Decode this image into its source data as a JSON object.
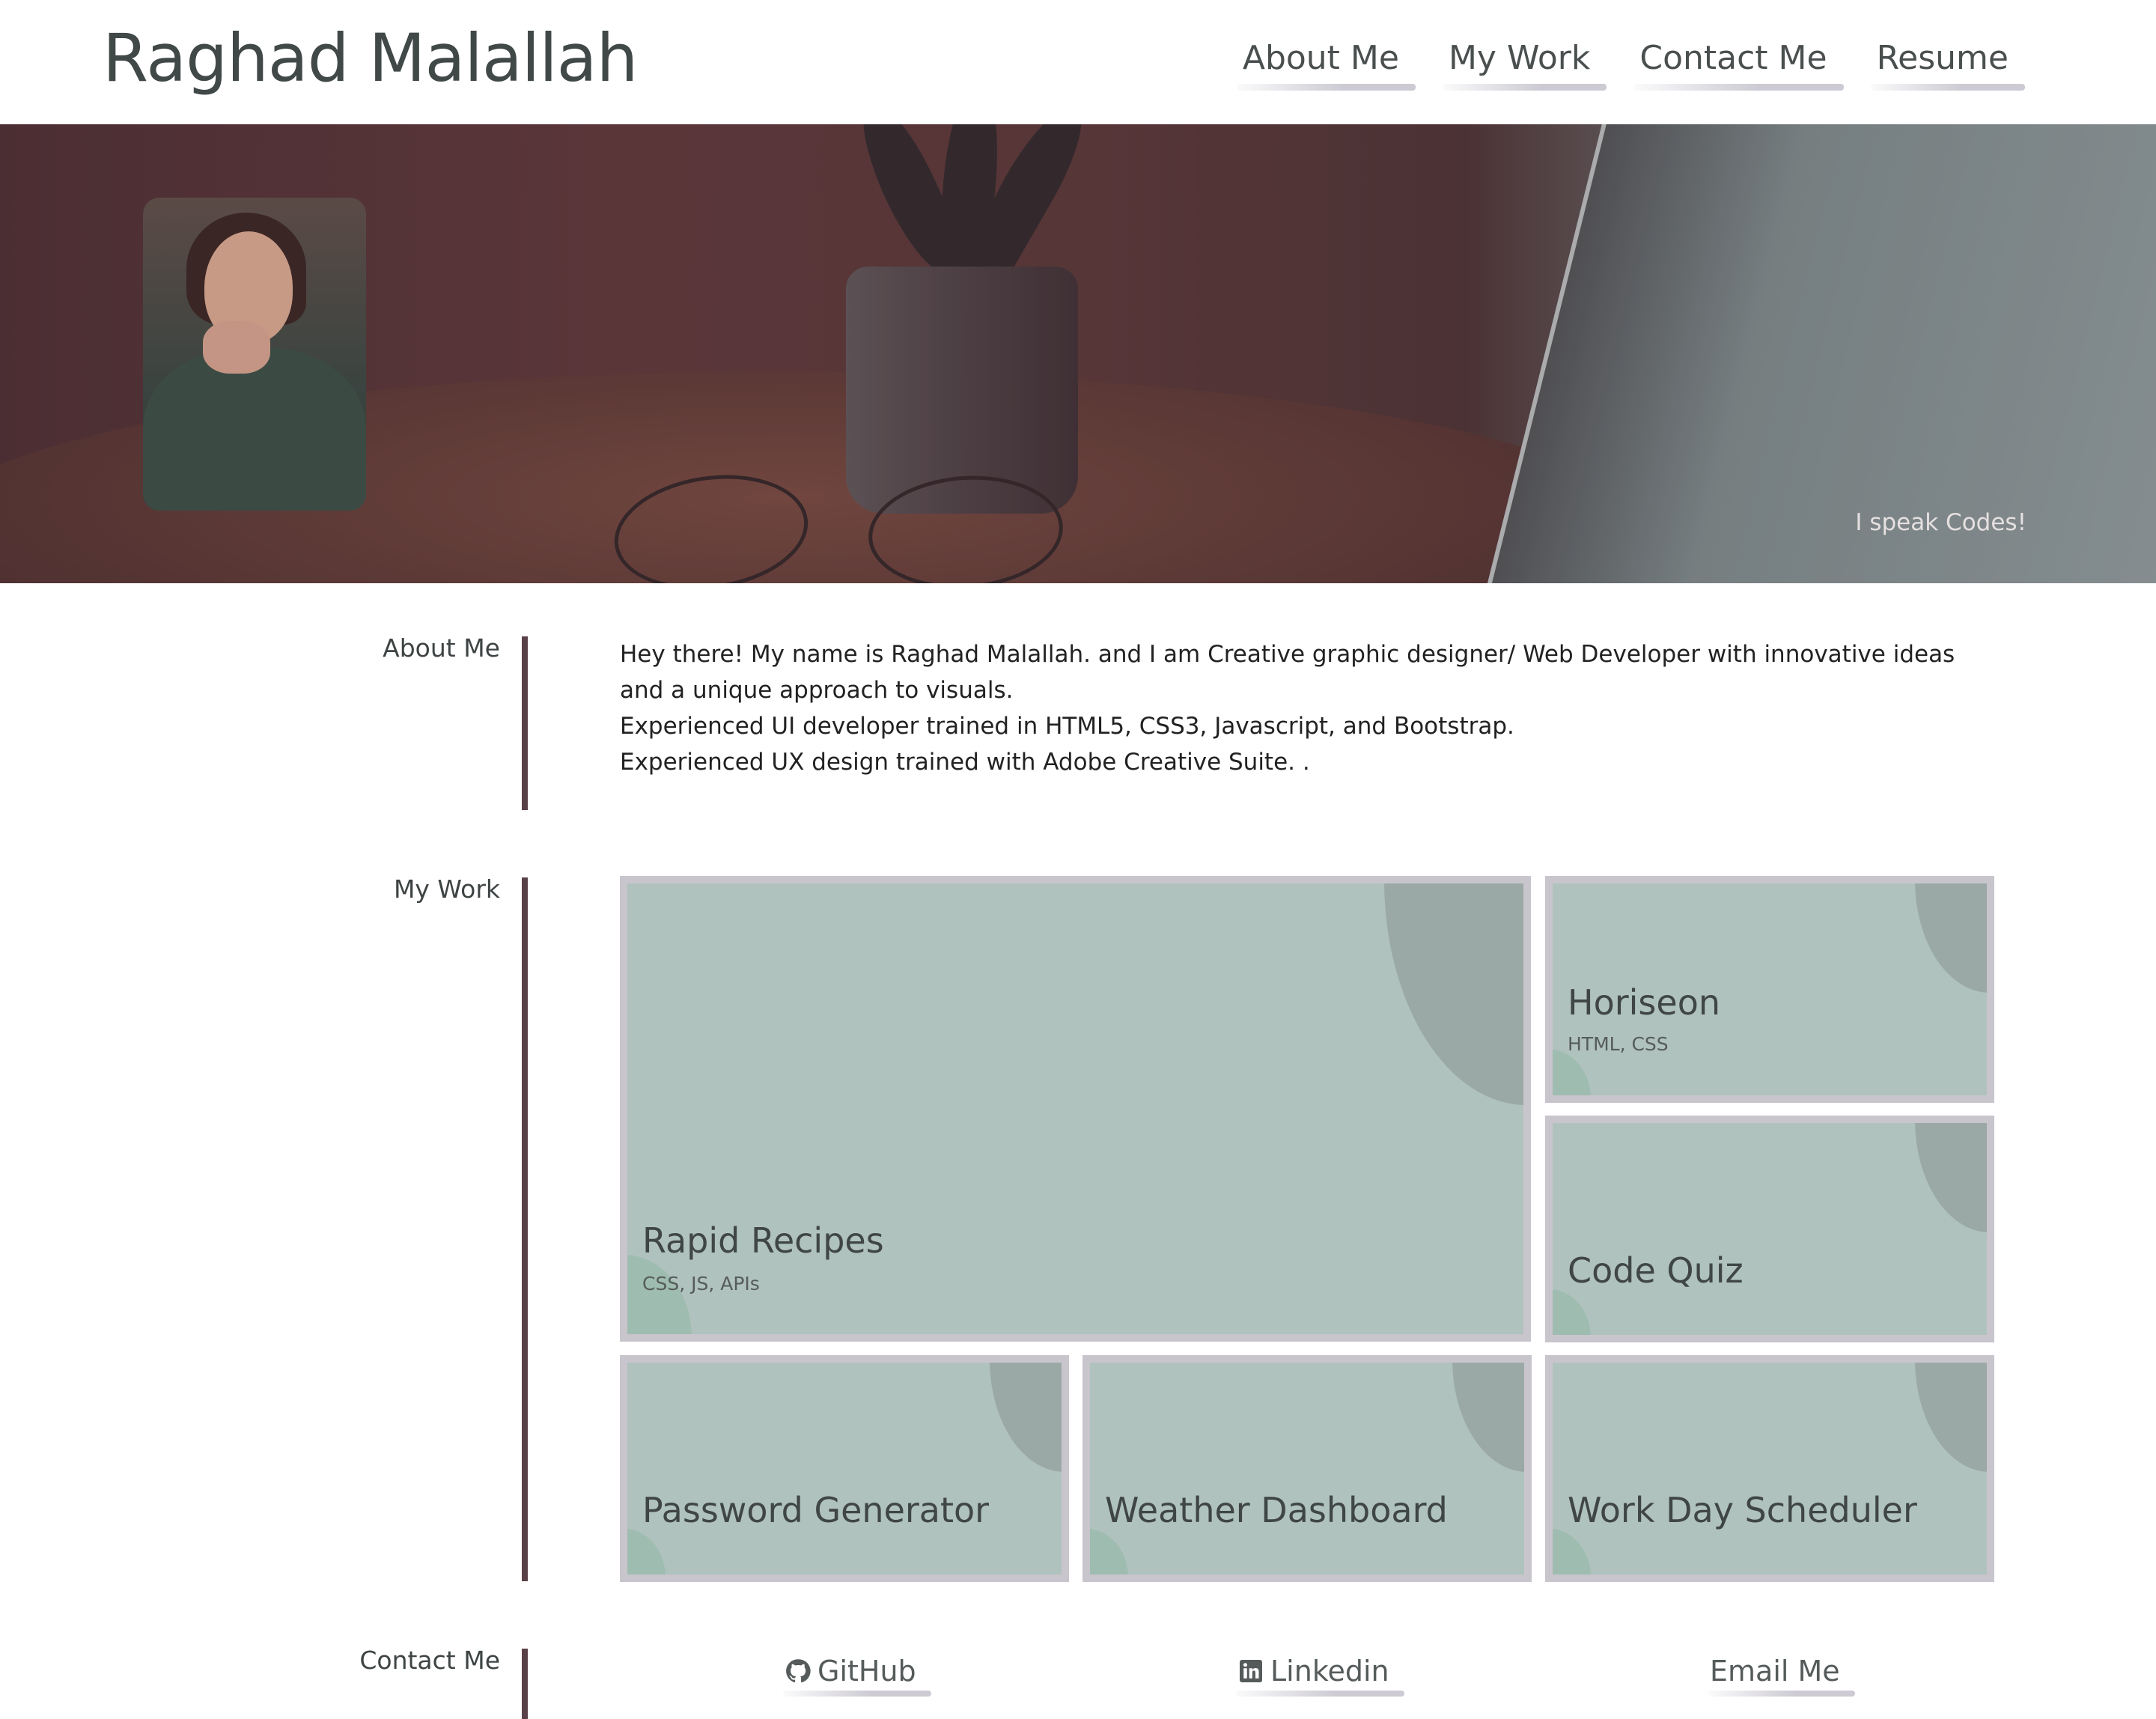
{
  "header": {
    "title": "Raghad Malallah",
    "nav": [
      "About Me",
      "My Work",
      "Contact Me",
      "Resume"
    ]
  },
  "hero": {
    "tagline": "I speak Codes!"
  },
  "about": {
    "label": "About Me",
    "lines": [
      "Hey there! My name is Raghad Malallah. and I am Creative graphic designer/ Web Developer with innovative ideas and a unique approach to visuals.",
      "Experienced UI developer trained in HTML5, CSS3, Javascript, and Bootstrap.",
      "Experienced UX design trained with Adobe Creative Suite. ."
    ]
  },
  "work": {
    "label": "My Work",
    "projects": [
      {
        "title": "Rapid Recipes",
        "tech": "CSS, JS, APIs"
      },
      {
        "title": "Horiseon",
        "tech": "HTML, CSS"
      },
      {
        "title": "Code Quiz",
        "tech": ""
      },
      {
        "title": "Password Generator",
        "tech": ""
      },
      {
        "title": "Weather Dashboard",
        "tech": ""
      },
      {
        "title": "Work Day Scheduler",
        "tech": ""
      }
    ]
  },
  "contact": {
    "label": "Contact Me",
    "links": [
      {
        "label": "GitHub",
        "icon": "github-icon"
      },
      {
        "label": "Linkedin",
        "icon": "linkedin-icon"
      },
      {
        "label": "Email Me",
        "icon": ""
      }
    ]
  },
  "colors": {
    "card_bg": "#b0c2be",
    "card_border": "#c9c5cc",
    "section_bar": "#5a4148",
    "text": "#3e4444"
  }
}
